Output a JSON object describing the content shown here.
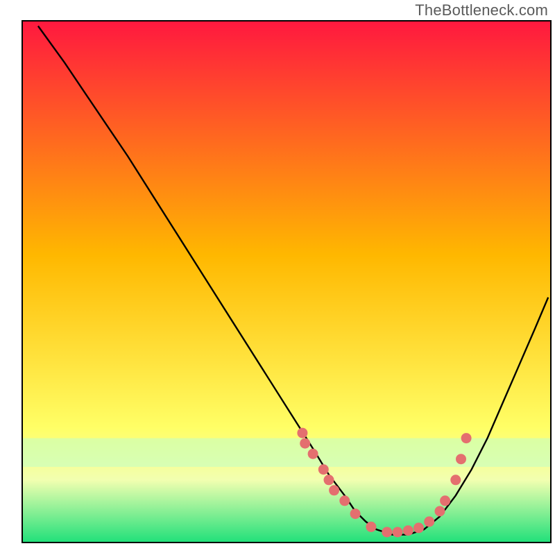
{
  "watermark": "TheBottleneck.com",
  "chart_data": {
    "type": "line",
    "title": "",
    "xlabel": "",
    "ylabel": "",
    "xlim": [
      0,
      100
    ],
    "ylim": [
      0,
      100
    ],
    "grid": false,
    "legend": false,
    "background_gradient": {
      "top": "#ff183f",
      "mid1": "#ffb800",
      "mid2": "#ffff66",
      "bottom": "#20e07a"
    },
    "series": [
      {
        "name": "bottleneck-curve",
        "type": "line",
        "color": "#000000",
        "x": [
          3,
          8,
          12,
          16,
          20,
          25,
          30,
          35,
          40,
          45,
          50,
          55,
          58,
          61,
          63,
          65,
          67,
          70,
          73,
          76,
          79,
          82,
          85,
          88,
          91,
          94,
          97,
          99.5
        ],
        "y": [
          99,
          92,
          86,
          80,
          74,
          66,
          58,
          50,
          42,
          34,
          26,
          18,
          13,
          9,
          6,
          4,
          2.5,
          1.5,
          1.5,
          2.5,
          5,
          9,
          14,
          20,
          27,
          34,
          41,
          47
        ]
      },
      {
        "name": "highlight-dots",
        "type": "scatter",
        "color": "#e46f6f",
        "x": [
          53,
          53.5,
          55,
          57,
          58,
          59,
          61,
          63,
          66,
          69,
          71,
          73,
          75,
          77,
          79,
          80,
          82,
          83,
          84
        ],
        "y": [
          21,
          19,
          17,
          14,
          12,
          10,
          8,
          5.5,
          3,
          2,
          2,
          2.3,
          2.8,
          4,
          6,
          8,
          12,
          16,
          20
        ]
      }
    ]
  }
}
